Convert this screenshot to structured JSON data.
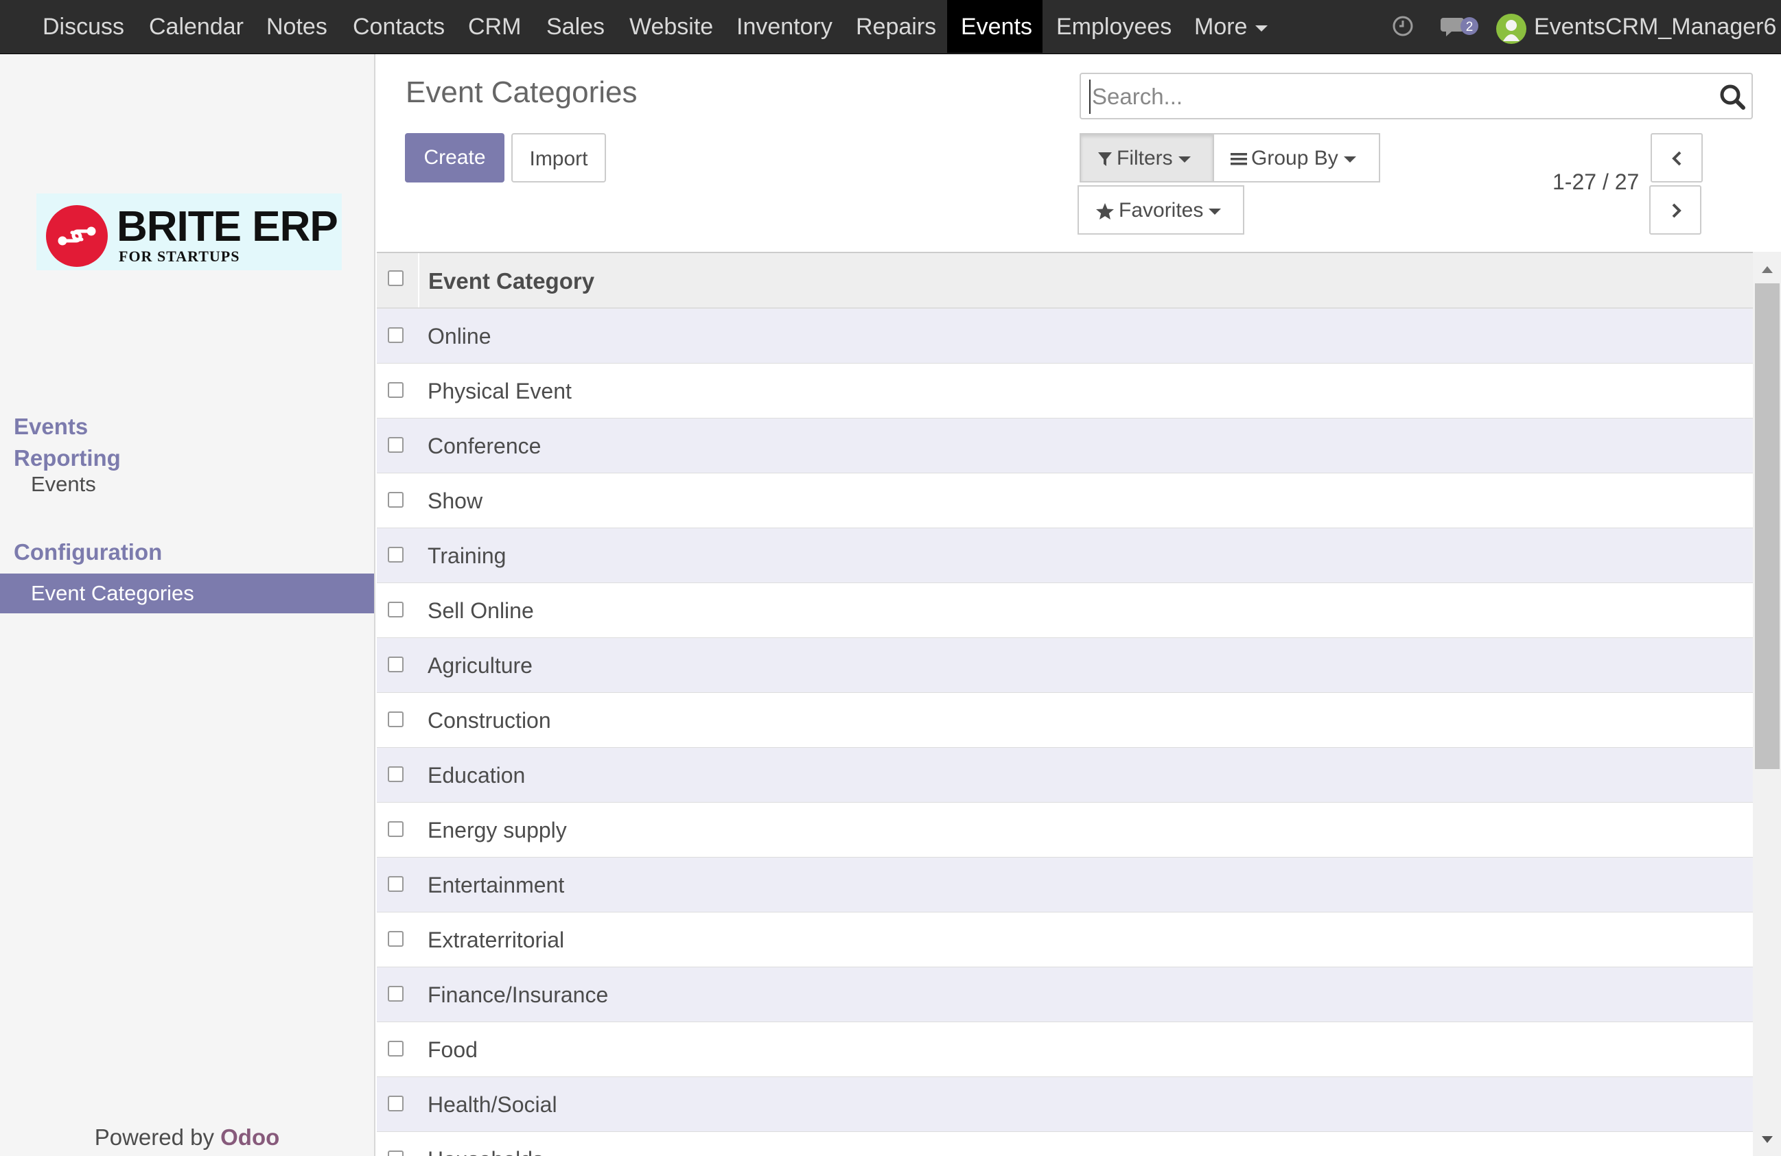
{
  "navbar": {
    "items": [
      {
        "label": "Discuss"
      },
      {
        "label": "Calendar"
      },
      {
        "label": "Notes"
      },
      {
        "label": "Contacts"
      },
      {
        "label": "CRM"
      },
      {
        "label": "Sales"
      },
      {
        "label": "Website"
      },
      {
        "label": "Inventory"
      },
      {
        "label": "Repairs"
      },
      {
        "label": "Events",
        "active": true
      },
      {
        "label": "Employees"
      }
    ],
    "more_label": "More",
    "chat_count": "2",
    "username": "EventsCRM_Manager6"
  },
  "sidebar": {
    "logo_title": "BRITE ERP",
    "logo_subtitle": "FOR STARTUPS",
    "sections": [
      {
        "heading": "Events",
        "items": []
      },
      {
        "heading": "Reporting",
        "items": [
          {
            "label": "Events"
          }
        ]
      },
      {
        "heading": "Configuration",
        "items": [
          {
            "label": "Event Categories",
            "active": true
          }
        ]
      }
    ],
    "powered_by": "Powered by",
    "powered_brand": "Odoo"
  },
  "control_panel": {
    "breadcrumb": "Event Categories",
    "create_label": "Create",
    "import_label": "Import",
    "search_placeholder": "Search...",
    "filters_label": "Filters",
    "groupby_label": "Group By",
    "favorites_label": "Favorites",
    "pager_value": "1-27 / 27"
  },
  "list": {
    "column_header": "Event Category",
    "rows": [
      "Online",
      "Physical Event",
      "Conference",
      "Show",
      "Training",
      "Sell Online",
      "Agriculture",
      "Construction",
      "Education",
      "Energy supply",
      "Entertainment",
      "Extraterritorial",
      "Finance/Insurance",
      "Food",
      "Health/Social",
      "Households"
    ]
  },
  "colors": {
    "accent": "#7c7bad",
    "navbar_bg": "#2d2d2d",
    "brand": "#875a7b",
    "logo_red": "#e21b36"
  }
}
